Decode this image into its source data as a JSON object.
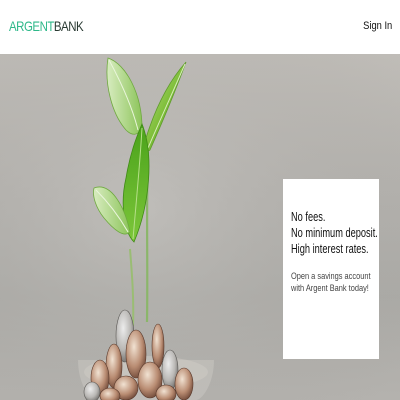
{
  "header": {
    "logo": {
      "part1": "ARGENT",
      "part2": "BANK"
    },
    "signin_label": "Sign In"
  },
  "promo": {
    "headline_lines": [
      "No fees.",
      "No minimum deposit.",
      "High interest rates."
    ],
    "cta_text": "Open a savings account with Argent Bank today!"
  },
  "colors": {
    "brand_green": "#2eb889",
    "brand_dark": "#2a3a33",
    "hero_background": "#b3b1ad",
    "card_background": "#ffffff"
  },
  "hero_image": {
    "subject": "plant-sprout-in-coins"
  }
}
